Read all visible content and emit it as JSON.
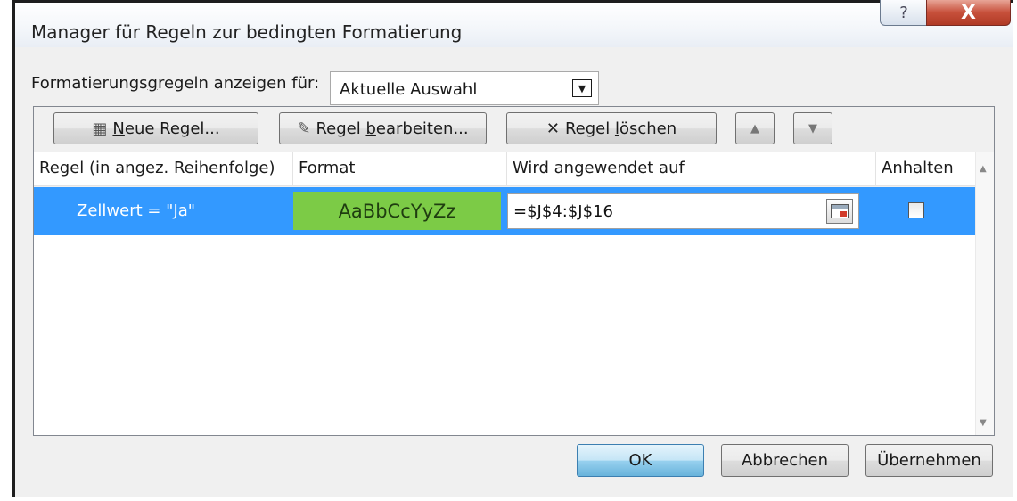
{
  "window": {
    "title": "Manager für Regeln zur bedingten Formatierung",
    "help_glyph": "?",
    "close_glyph": "X"
  },
  "show_rules": {
    "label_pre": "Formatierungs",
    "label_accel": "g",
    "label_post": "regeln anzeigen für:",
    "selected": "Aktuelle Auswahl",
    "arrow_glyph": "▼"
  },
  "toolbar": {
    "new_rule": {
      "accel": "N",
      "rest": "eue Regel...",
      "icon": "new-rule-icon"
    },
    "edit_rule": {
      "pre": "Regel ",
      "accel": "b",
      "rest": "earbeiten...",
      "icon": "edit-rule-icon"
    },
    "delete_rule": {
      "pre": "Regel ",
      "accel": "l",
      "rest": "öschen",
      "icon": "delete-icon",
      "glyph": "✕"
    },
    "move_up_glyph": "▲",
    "move_down_glyph": "▼"
  },
  "table": {
    "columns": [
      "Regel (in angez. Reihenfolge)",
      "Format",
      "Wird angewendet auf",
      "Anhalten"
    ],
    "rows": [
      {
        "rule": "Zellwert = \"Ja\"",
        "format_preview": "AaBbCcYyZz",
        "applies_to": "=$J$4:$J$16",
        "stop_if_true": false,
        "selected": true
      }
    ],
    "scroll_up_glyph": "▲",
    "scroll_down_glyph": "▼"
  },
  "footer": {
    "ok": "OK",
    "cancel": "Abbrechen",
    "apply": "Übernehmen"
  },
  "colors": {
    "selection": "#3399ff",
    "format_fill": "#7ccb46",
    "close_button": "#c7503b"
  }
}
